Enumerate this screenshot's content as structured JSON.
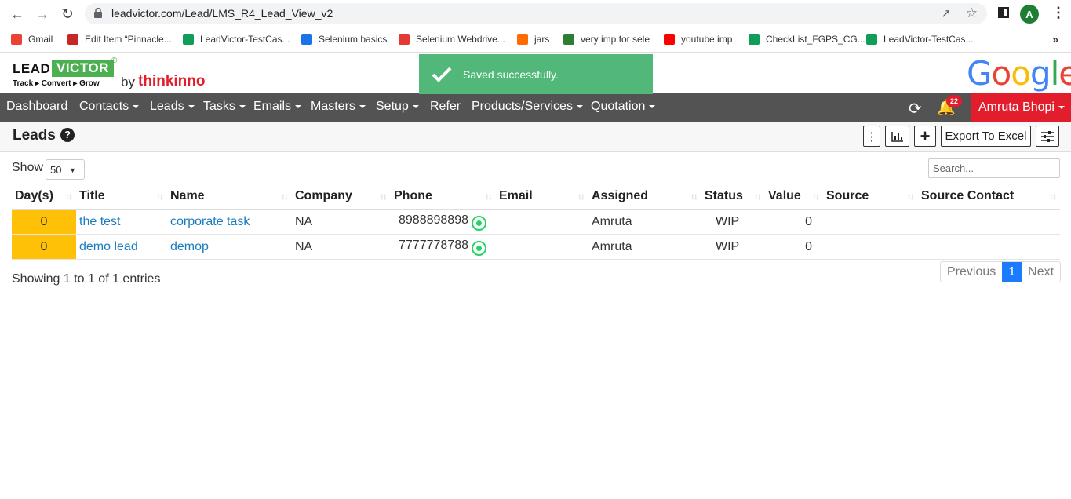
{
  "browser": {
    "url": "leadvictor.com/Lead/LMS_R4_Lead_View_v2",
    "profile_initial": "A",
    "bookmarks": [
      {
        "label": "Gmail",
        "icon": "gmail-icon",
        "color": "#ea4335"
      },
      {
        "label": "Edit Item “Pinnacle...",
        "icon": "edit-item-icon",
        "color": "#c62828"
      },
      {
        "label": "LeadVictor-TestCas...",
        "icon": "sheets-icon",
        "color": "#0f9d58"
      },
      {
        "label": "Selenium basics",
        "icon": "selenium-icon",
        "color": "#1a73e8"
      },
      {
        "label": "Selenium Webdrive...",
        "icon": "webdriver-icon",
        "color": "#e53935"
      },
      {
        "label": "jars",
        "icon": "blogger-icon",
        "color": "#ff6d00"
      },
      {
        "label": "very imp for sele",
        "icon": "s-icon",
        "color": "#2e7d32"
      },
      {
        "label": "youtube imp",
        "icon": "youtube-icon",
        "color": "#ff0000"
      },
      {
        "label": "CheckList_FGPS_CG...",
        "icon": "sheets-icon",
        "color": "#0f9d58"
      },
      {
        "label": "LeadVictor-TestCas...",
        "icon": "sheets-icon",
        "color": "#0f9d58"
      }
    ],
    "more": "»"
  },
  "brand": {
    "lead": "LEAD",
    "victor": "VICTOR",
    "reg": "®",
    "tagline": "Track ▸ Convert ▸ Grow",
    "by": "by",
    "thinkinno": "thinkinno",
    "google": "Google"
  },
  "toast": {
    "message": "Saved successfully."
  },
  "nav": {
    "items": [
      {
        "label": "Dashboard",
        "dropdown": false
      },
      {
        "label": "Contacts",
        "dropdown": true
      },
      {
        "label": "Leads",
        "dropdown": true
      },
      {
        "label": "Tasks",
        "dropdown": true
      },
      {
        "label": "Emails",
        "dropdown": true
      },
      {
        "label": "Masters",
        "dropdown": true
      },
      {
        "label": "Setup",
        "dropdown": true
      },
      {
        "label": "Refer",
        "dropdown": false
      },
      {
        "label": "Products/Services",
        "dropdown": true
      },
      {
        "label": "Quotation",
        "dropdown": true
      }
    ],
    "notification_count": "22",
    "user": "Amruta Bhopi"
  },
  "page": {
    "title": "Leads",
    "help": "?",
    "export": "Export To Excel"
  },
  "controls": {
    "show_label": "Show",
    "page_size": "50",
    "search_placeholder": "Search..."
  },
  "table": {
    "columns": [
      "Day(s)",
      "Title",
      "Name",
      "Company",
      "Phone",
      "Email",
      "Assigned",
      "Status",
      "Value",
      "Source",
      "Source Contact"
    ],
    "rows": [
      {
        "days": "0",
        "title": "the test",
        "name": "corporate task",
        "company": "NA",
        "phone": "8988898898",
        "email": "",
        "assigned": "Amruta",
        "status": "WIP",
        "value": "0",
        "source": "",
        "source_contact": ""
      },
      {
        "days": "0",
        "title": "demo lead",
        "name": "demop",
        "company": "NA",
        "phone": "7777778788",
        "email": "",
        "assigned": "Amruta",
        "status": "WIP",
        "value": "0",
        "source": "",
        "source_contact": ""
      }
    ]
  },
  "footer": {
    "info": "Showing 1 to 1 of 1 entries",
    "previous": "Previous",
    "current_page": "1",
    "next": "Next"
  }
}
